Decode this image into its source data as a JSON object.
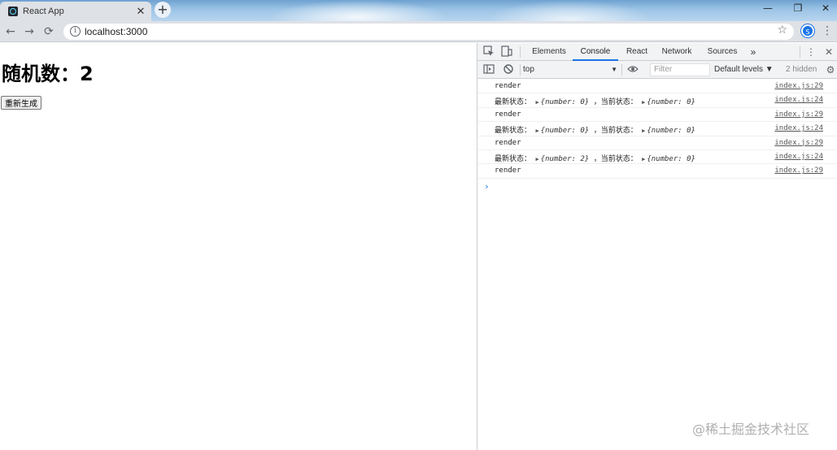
{
  "browser": {
    "tab_title": "React App",
    "tab_close": "✕",
    "new_tab": "+",
    "url": "localhost:3000",
    "window_controls": [
      "—",
      "❐",
      "✕"
    ],
    "profile_initial": "S",
    "back": "←",
    "forward": "→",
    "reload": "⟳",
    "star": "☆",
    "menu": "⋮"
  },
  "page": {
    "heading": "随机数：2",
    "regenerate_button": "重新生成"
  },
  "devtools": {
    "tabs": [
      "Elements",
      "Console",
      "React",
      "Network",
      "Sources"
    ],
    "active_tab": "Console",
    "more": "»",
    "context": "top",
    "filter_placeholder": "Filter",
    "levels": "Default levels ▼",
    "hidden_count": "2 hidden",
    "console_rows": [
      {
        "label": "render",
        "source": "index.js:29"
      },
      {
        "label": "最新状态：",
        "obj1": "{number: 0}",
        "sep": "，当前状态：",
        "obj2": "{number: 0}",
        "source": "index.js:24"
      },
      {
        "label": "render",
        "source": "index.js:29"
      },
      {
        "label": "最新状态：",
        "obj1": "{number: 0}",
        "sep": "，当前状态：",
        "obj2": "{number: 0}",
        "source": "index.js:24"
      },
      {
        "label": "render",
        "source": "index.js:29"
      },
      {
        "label": "最新状态：",
        "obj1": "{number: 2}",
        "sep": "，当前状态：",
        "obj2": "{number: 0}",
        "source": "index.js:24"
      },
      {
        "label": "render",
        "source": "index.js:29"
      }
    ],
    "prompt": "›"
  },
  "watermark": "@稀土掘金技术社区"
}
